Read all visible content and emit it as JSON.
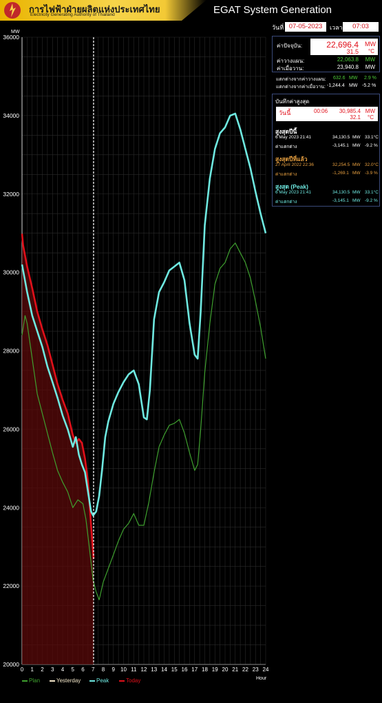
{
  "header": {
    "brand_th": "การไฟฟ้าฝ่ายผลิตแห่งประเทศไทย",
    "brand_en": "Electricity Generating Authority of Thailand",
    "app_title": "EGAT System Generation"
  },
  "datetime": {
    "date_label": "วันที่",
    "date_value": "07-05-2023",
    "time_label": "เวลา",
    "time_value": "07:03"
  },
  "current": {
    "label": "ค่าปัจจุบัน:",
    "mw": "22,696.4",
    "mw_unit": "MW",
    "temp": "31.5",
    "temp_unit": "°C",
    "plan_label": "ค่าวางแผน:",
    "plan_value": "22,063.8",
    "plan_unit": "MW",
    "yesterday_label": "ค่าเมื่อวาน:",
    "yesterday_value": "23,940.8",
    "yesterday_unit": "MW"
  },
  "diffs": {
    "plan_label": "แตกต่างจากค่าวางแผน:",
    "plan_mw": "632.6",
    "plan_mw_unit": "MW",
    "plan_pct": "2.9 %",
    "yest_label": "แตกต่างจากค่าเมื่อวาน:",
    "yest_mw": "-1,244.4",
    "yest_mw_unit": "MW",
    "yest_pct": "-5.2 %"
  },
  "records": {
    "title": "บันทึกค่าสูงสุด",
    "today": {
      "label": "วันนี้",
      "time": "00:06",
      "mw": "30,985.4",
      "mw_unit": "MW",
      "temp": "32.1",
      "temp_unit": "°C"
    },
    "year_peak": {
      "title": "สูงสุดปีนี้",
      "date": "6 May 2023 21:41",
      "mw": "34,130.5",
      "mw_unit": "MW",
      "temp": "33.1°C",
      "diff_label": "ค่าแตกต่าง",
      "diff_mw": "-3,145.1",
      "diff_unit": "MW",
      "diff_pct": "-9.2 %"
    },
    "last_year_peak": {
      "title": "สูงสุดปีที่แล้ว",
      "date": "27 April 2022 22:36",
      "mw": "32,254.5",
      "mw_unit": "MW",
      "temp": "32.0°C",
      "diff_label": "ค่าแตกต่าง",
      "diff_mw": "-1,269.1",
      "diff_unit": "MW",
      "diff_pct": "-3.9 %"
    },
    "all_time_peak": {
      "title": "สูงสุด (Peak)",
      "date": "6 May 2023 21:41",
      "mw": "34,130.5",
      "mw_unit": "MW",
      "temp": "33.1°C",
      "diff_label": "ค่าแตกต่าง",
      "diff_mw": "-3,145.1",
      "diff_unit": "MW",
      "diff_pct": "-9.2 %"
    }
  },
  "colors": {
    "plan": "#3fa12f",
    "yesterday": "#f3e6c8",
    "peak": "#6ee8e0",
    "today": "#e0101a",
    "today_fill": "#5a0a0a",
    "grid": "#2b2b2b",
    "title_red": "#e0101a",
    "record_orange": "#e8a040",
    "record_cyan": "#6ee8e0"
  },
  "chart_data": {
    "type": "line",
    "ylabel": "MW",
    "xlabel": "Hour",
    "ylim": [
      20000,
      36000
    ],
    "xlim": [
      0,
      24
    ],
    "yticks": [
      20000,
      22000,
      24000,
      26000,
      28000,
      30000,
      32000,
      34000,
      36000
    ],
    "xticks": [
      0,
      1,
      2,
      3,
      4,
      5,
      6,
      7,
      8,
      9,
      10,
      11,
      12,
      13,
      14,
      15,
      16,
      17,
      18,
      19,
      20,
      21,
      22,
      23,
      24
    ],
    "current_time_marker": 7.05,
    "legend": [
      "Plan",
      "Yesterday",
      "Peak",
      "Today"
    ],
    "series": [
      {
        "name": "Plan",
        "x": [
          0,
          0.3,
          0.5,
          1,
          1.5,
          2,
          2.5,
          3,
          3.5,
          4,
          4.5,
          5,
          5.5,
          6,
          6.3,
          6.6,
          7,
          7.3,
          7.6,
          8,
          8.5,
          9,
          9.5,
          10,
          10.5,
          11,
          11.5,
          12,
          12.5,
          13,
          13.5,
          14,
          14.5,
          15,
          15.5,
          16,
          16.5,
          17,
          17.3,
          17.6,
          18,
          18.5,
          19,
          19.5,
          20,
          20.5,
          21,
          21.5,
          22,
          22.5,
          23,
          23.5,
          24
        ],
        "y": [
          28400,
          28900,
          28700,
          27800,
          26900,
          26400,
          25900,
          25400,
          24950,
          24650,
          24400,
          24000,
          24200,
          24100,
          23700,
          23050,
          22150,
          21850,
          21650,
          22100,
          22450,
          22800,
          23150,
          23450,
          23600,
          23850,
          23550,
          23550,
          24150,
          24900,
          25550,
          25850,
          26100,
          26150,
          26250,
          25900,
          25400,
          24950,
          25100,
          26000,
          27450,
          28700,
          29700,
          30100,
          30250,
          30600,
          30750,
          30500,
          30250,
          29850,
          29250,
          28600,
          27800
        ]
      },
      {
        "name": "Yesterday",
        "x": [],
        "y": []
      },
      {
        "name": "Peak",
        "x": [
          0,
          0.5,
          1,
          1.5,
          2,
          2.5,
          3,
          3.5,
          4,
          4.5,
          5,
          5.3,
          5.6,
          5.9,
          6.2,
          6.5,
          6.8,
          7,
          7.3,
          7.6,
          7.9,
          8.2,
          8.5,
          9,
          9.5,
          10,
          10.5,
          11,
          11.5,
          12,
          12.3,
          12.6,
          13,
          13.5,
          14,
          14.5,
          15,
          15.5,
          16,
          16.5,
          17,
          17.3,
          17.6,
          18,
          18.5,
          19,
          19.5,
          20,
          20.5,
          21,
          21.5,
          22,
          22.5,
          23,
          23.5,
          24
        ],
        "y": [
          30200,
          29500,
          28900,
          28500,
          28100,
          27600,
          27200,
          26800,
          26350,
          26000,
          25550,
          25800,
          25350,
          25100,
          24900,
          24400,
          23900,
          23800,
          23900,
          24300,
          25000,
          25800,
          26200,
          26650,
          26950,
          27200,
          27400,
          27500,
          27150,
          26300,
          26250,
          27000,
          28800,
          29500,
          29750,
          30050,
          30150,
          30250,
          29800,
          28700,
          27900,
          27800,
          29000,
          31200,
          32400,
          33150,
          33550,
          33700,
          34000,
          34050,
          33650,
          33150,
          32650,
          32050,
          31500,
          31000
        ]
      },
      {
        "name": "Today",
        "x": [
          0,
          0.1,
          0.5,
          1,
          1.5,
          2,
          2.5,
          3,
          3.5,
          4,
          4.5,
          5,
          5.3,
          5.6,
          5.9,
          6.2,
          6.5,
          6.8,
          7.05
        ],
        "y": [
          30985,
          30700,
          30150,
          29600,
          29000,
          28550,
          28150,
          27650,
          27150,
          26750,
          26400,
          25850,
          25650,
          25750,
          25650,
          25250,
          24650,
          23550,
          22700
        ]
      }
    ]
  }
}
